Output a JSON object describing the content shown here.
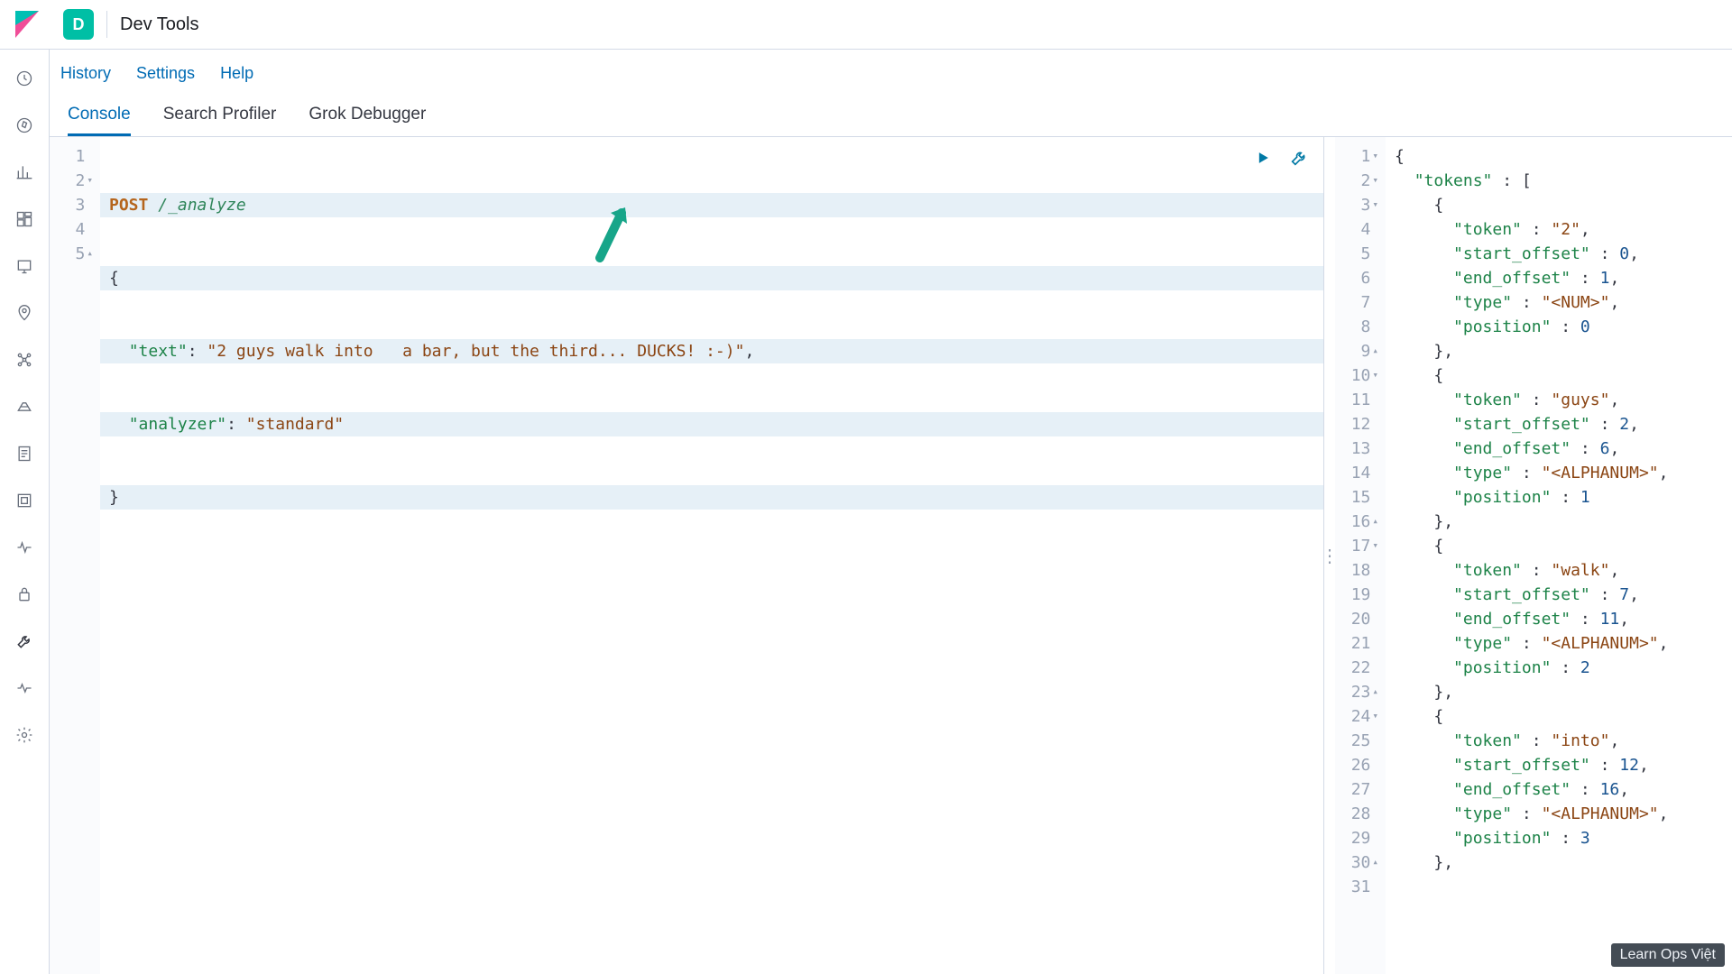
{
  "header": {
    "app_badge": "D",
    "title": "Dev Tools"
  },
  "submenu": {
    "history": "History",
    "settings": "Settings",
    "help": "Help"
  },
  "tabs": {
    "console": "Console",
    "search_profiler": "Search Profiler",
    "grok_debugger": "Grok Debugger"
  },
  "editor": {
    "gutter": [
      "1",
      "2",
      "3",
      "4",
      "5"
    ],
    "fold": [
      "",
      "▾",
      "",
      "",
      "▴"
    ],
    "method": "POST",
    "path": "/_analyze",
    "brace_open": "{",
    "key_text": "\"text\"",
    "sep": ": ",
    "val_text": "\"2 guys walk into   a bar, but the third... DUCKS! :-)\"",
    "comma": ",",
    "key_analyzer": "\"analyzer\"",
    "val_analyzer": "\"standard\"",
    "brace_close": "}"
  },
  "response": {
    "lines": [
      {
        "n": "1",
        "fold": "▾",
        "indent": 0,
        "parts": [
          {
            "t": "pun",
            "v": "{"
          }
        ]
      },
      {
        "n": "2",
        "fold": "▾",
        "indent": 1,
        "parts": [
          {
            "t": "key",
            "v": "\"tokens\""
          },
          {
            "t": "pun",
            "v": " : ["
          }
        ]
      },
      {
        "n": "3",
        "fold": "▾",
        "indent": 2,
        "parts": [
          {
            "t": "pun",
            "v": "{"
          }
        ]
      },
      {
        "n": "4",
        "fold": "",
        "indent": 3,
        "parts": [
          {
            "t": "key",
            "v": "\"token\""
          },
          {
            "t": "pun",
            "v": " : "
          },
          {
            "t": "str",
            "v": "\"2\""
          },
          {
            "t": "pun",
            "v": ","
          }
        ]
      },
      {
        "n": "5",
        "fold": "",
        "indent": 3,
        "parts": [
          {
            "t": "key",
            "v": "\"start_offset\""
          },
          {
            "t": "pun",
            "v": " : "
          },
          {
            "t": "num",
            "v": "0"
          },
          {
            "t": "pun",
            "v": ","
          }
        ]
      },
      {
        "n": "6",
        "fold": "",
        "indent": 3,
        "parts": [
          {
            "t": "key",
            "v": "\"end_offset\""
          },
          {
            "t": "pun",
            "v": " : "
          },
          {
            "t": "num",
            "v": "1"
          },
          {
            "t": "pun",
            "v": ","
          }
        ]
      },
      {
        "n": "7",
        "fold": "",
        "indent": 3,
        "parts": [
          {
            "t": "key",
            "v": "\"type\""
          },
          {
            "t": "pun",
            "v": " : "
          },
          {
            "t": "str",
            "v": "\"<NUM>\""
          },
          {
            "t": "pun",
            "v": ","
          }
        ]
      },
      {
        "n": "8",
        "fold": "",
        "indent": 3,
        "parts": [
          {
            "t": "key",
            "v": "\"position\""
          },
          {
            "t": "pun",
            "v": " : "
          },
          {
            "t": "num",
            "v": "0"
          }
        ]
      },
      {
        "n": "9",
        "fold": "▴",
        "indent": 2,
        "parts": [
          {
            "t": "pun",
            "v": "},"
          }
        ]
      },
      {
        "n": "10",
        "fold": "▾",
        "indent": 2,
        "parts": [
          {
            "t": "pun",
            "v": "{"
          }
        ]
      },
      {
        "n": "11",
        "fold": "",
        "indent": 3,
        "parts": [
          {
            "t": "key",
            "v": "\"token\""
          },
          {
            "t": "pun",
            "v": " : "
          },
          {
            "t": "str",
            "v": "\"guys\""
          },
          {
            "t": "pun",
            "v": ","
          }
        ]
      },
      {
        "n": "12",
        "fold": "",
        "indent": 3,
        "parts": [
          {
            "t": "key",
            "v": "\"start_offset\""
          },
          {
            "t": "pun",
            "v": " : "
          },
          {
            "t": "num",
            "v": "2"
          },
          {
            "t": "pun",
            "v": ","
          }
        ]
      },
      {
        "n": "13",
        "fold": "",
        "indent": 3,
        "parts": [
          {
            "t": "key",
            "v": "\"end_offset\""
          },
          {
            "t": "pun",
            "v": " : "
          },
          {
            "t": "num",
            "v": "6"
          },
          {
            "t": "pun",
            "v": ","
          }
        ]
      },
      {
        "n": "14",
        "fold": "",
        "indent": 3,
        "parts": [
          {
            "t": "key",
            "v": "\"type\""
          },
          {
            "t": "pun",
            "v": " : "
          },
          {
            "t": "str",
            "v": "\"<ALPHANUM>\""
          },
          {
            "t": "pun",
            "v": ","
          }
        ]
      },
      {
        "n": "15",
        "fold": "",
        "indent": 3,
        "parts": [
          {
            "t": "key",
            "v": "\"position\""
          },
          {
            "t": "pun",
            "v": " : "
          },
          {
            "t": "num",
            "v": "1"
          }
        ]
      },
      {
        "n": "16",
        "fold": "▴",
        "indent": 2,
        "parts": [
          {
            "t": "pun",
            "v": "},"
          }
        ]
      },
      {
        "n": "17",
        "fold": "▾",
        "indent": 2,
        "parts": [
          {
            "t": "pun",
            "v": "{"
          }
        ]
      },
      {
        "n": "18",
        "fold": "",
        "indent": 3,
        "parts": [
          {
            "t": "key",
            "v": "\"token\""
          },
          {
            "t": "pun",
            "v": " : "
          },
          {
            "t": "str",
            "v": "\"walk\""
          },
          {
            "t": "pun",
            "v": ","
          }
        ]
      },
      {
        "n": "19",
        "fold": "",
        "indent": 3,
        "parts": [
          {
            "t": "key",
            "v": "\"start_offset\""
          },
          {
            "t": "pun",
            "v": " : "
          },
          {
            "t": "num",
            "v": "7"
          },
          {
            "t": "pun",
            "v": ","
          }
        ]
      },
      {
        "n": "20",
        "fold": "",
        "indent": 3,
        "parts": [
          {
            "t": "key",
            "v": "\"end_offset\""
          },
          {
            "t": "pun",
            "v": " : "
          },
          {
            "t": "num",
            "v": "11"
          },
          {
            "t": "pun",
            "v": ","
          }
        ]
      },
      {
        "n": "21",
        "fold": "",
        "indent": 3,
        "parts": [
          {
            "t": "key",
            "v": "\"type\""
          },
          {
            "t": "pun",
            "v": " : "
          },
          {
            "t": "str",
            "v": "\"<ALPHANUM>\""
          },
          {
            "t": "pun",
            "v": ","
          }
        ]
      },
      {
        "n": "22",
        "fold": "",
        "indent": 3,
        "parts": [
          {
            "t": "key",
            "v": "\"position\""
          },
          {
            "t": "pun",
            "v": " : "
          },
          {
            "t": "num",
            "v": "2"
          }
        ]
      },
      {
        "n": "23",
        "fold": "▴",
        "indent": 2,
        "parts": [
          {
            "t": "pun",
            "v": "},"
          }
        ]
      },
      {
        "n": "24",
        "fold": "▾",
        "indent": 2,
        "parts": [
          {
            "t": "pun",
            "v": "{"
          }
        ]
      },
      {
        "n": "25",
        "fold": "",
        "indent": 3,
        "parts": [
          {
            "t": "key",
            "v": "\"token\""
          },
          {
            "t": "pun",
            "v": " : "
          },
          {
            "t": "str",
            "v": "\"into\""
          },
          {
            "t": "pun",
            "v": ","
          }
        ]
      },
      {
        "n": "26",
        "fold": "",
        "indent": 3,
        "parts": [
          {
            "t": "key",
            "v": "\"start_offset\""
          },
          {
            "t": "pun",
            "v": " : "
          },
          {
            "t": "num",
            "v": "12"
          },
          {
            "t": "pun",
            "v": ","
          }
        ]
      },
      {
        "n": "27",
        "fold": "",
        "indent": 3,
        "parts": [
          {
            "t": "key",
            "v": "\"end_offset\""
          },
          {
            "t": "pun",
            "v": " : "
          },
          {
            "t": "num",
            "v": "16"
          },
          {
            "t": "pun",
            "v": ","
          }
        ]
      },
      {
        "n": "28",
        "fold": "",
        "indent": 3,
        "parts": [
          {
            "t": "key",
            "v": "\"type\""
          },
          {
            "t": "pun",
            "v": " : "
          },
          {
            "t": "str",
            "v": "\"<ALPHANUM>\""
          },
          {
            "t": "pun",
            "v": ","
          }
        ]
      },
      {
        "n": "29",
        "fold": "",
        "indent": 3,
        "parts": [
          {
            "t": "key",
            "v": "\"position\""
          },
          {
            "t": "pun",
            "v": " : "
          },
          {
            "t": "num",
            "v": "3"
          }
        ]
      },
      {
        "n": "30",
        "fold": "▴",
        "indent": 2,
        "parts": [
          {
            "t": "pun",
            "v": "},"
          }
        ]
      },
      {
        "n": "31",
        "fold": "",
        "indent": 2,
        "parts": []
      }
    ]
  },
  "watermark": "Learn Ops Việt"
}
